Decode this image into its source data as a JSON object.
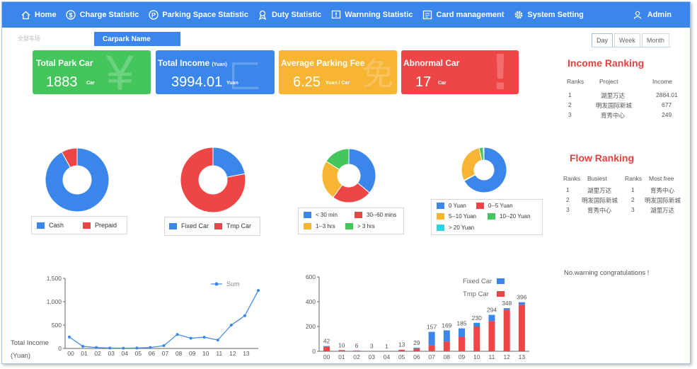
{
  "nav": {
    "items": [
      {
        "label": "Home",
        "icon": "home-icon"
      },
      {
        "label": "Charge Statistic",
        "icon": "dollar-icon"
      },
      {
        "label": "Parking Space Statistic",
        "icon": "parking-icon"
      },
      {
        "label": "Duty Statistic",
        "icon": "duty-icon"
      },
      {
        "label": "Warnning Statistic",
        "icon": "warning-icon"
      },
      {
        "label": "Card management",
        "icon": "card-icon"
      },
      {
        "label": "System Setting",
        "icon": "gear-icon"
      }
    ],
    "user": "Admin"
  },
  "filter": {
    "selected": "全部车场",
    "carpark_label": "Carpark Name"
  },
  "range_tabs": [
    "Day",
    "Week",
    "Month"
  ],
  "colors": {
    "nav_blue": "#3a86ea",
    "green": "#45c65c",
    "blue": "#3a86ea",
    "orange": "#f8b433",
    "red": "#ee4646",
    "cyan": "#2ed3e6"
  },
  "cards": [
    {
      "title": "Total Park Car",
      "title_unit": "",
      "value": "1883",
      "unit": "Car",
      "bg_glyph": "(¥"
    },
    {
      "title": "Total Income",
      "title_unit": "(Yuan)",
      "value": "3994.01",
      "unit": "Yuan",
      "bg_glyph": "¬"
    },
    {
      "title": "Average Parking Fee",
      "title_unit": "",
      "value": "6.25",
      "unit": "Yuan / Car",
      "bg_glyph": "免"
    },
    {
      "title": "Abnormal  Car",
      "title_unit": "",
      "value": "17",
      "unit": "Car",
      "bg_glyph": "!"
    }
  ],
  "income_ranking": {
    "title": "Income Ranking",
    "headers": [
      "Ranks",
      "Project",
      "Income"
    ],
    "rows": [
      [
        "1",
        "湖里万达",
        "2884.01"
      ],
      [
        "2",
        "明发国际新城",
        "677"
      ],
      [
        "3",
        "育秀中心",
        "249"
      ]
    ]
  },
  "flow_ranking": {
    "title": "Flow Ranking",
    "headers": [
      "Ranks",
      "Busiest",
      "Ranks",
      "Most free"
    ],
    "rows": [
      [
        "1",
        "湖里万达",
        "1",
        "育秀中心"
      ],
      [
        "2",
        "明发国际新城",
        "2",
        "明发国际新城"
      ],
      [
        "3",
        "育秀中心",
        "3",
        "湖里万达"
      ]
    ]
  },
  "warning_text": "No.warning  congratulations !",
  "pie_legends": {
    "pay": [
      "Cash",
      "Prepaid"
    ],
    "cartype": [
      "Fixed Car",
      "Tmp Car"
    ],
    "duration": [
      "< 30 min",
      "30--60 mins",
      "1--3 hrs",
      "> 3 hrs"
    ],
    "fee": [
      "0 Yuan",
      "0--5 Yuan",
      "5--10 Yuan",
      "10--20 Yuan",
      "> 20 Yuan"
    ]
  },
  "chart_data": [
    {
      "type": "pie",
      "categories": [
        "Cash",
        "Prepaid"
      ],
      "values": [
        92,
        8
      ],
      "colors": [
        "#3a86ea",
        "#ee4646"
      ]
    },
    {
      "type": "pie",
      "categories": [
        "Fixed Car",
        "Tmp Car"
      ],
      "values": [
        22,
        78
      ],
      "colors": [
        "#3a86ea",
        "#ee4646"
      ]
    },
    {
      "type": "pie",
      "categories": [
        "< 30 min",
        "30--60 mins",
        "1--3 hrs",
        "> 3 hrs"
      ],
      "values": [
        36,
        24,
        24,
        16
      ],
      "colors": [
        "#3a86ea",
        "#ee4646",
        "#f8b433",
        "#45c65c"
      ]
    },
    {
      "type": "pie",
      "categories": [
        "0 Yuan",
        "0--5 Yuan",
        "5--10 Yuan",
        "10--20 Yuan",
        "> 20 Yuan"
      ],
      "values": [
        67,
        0.5,
        29,
        3,
        0.5
      ],
      "colors": [
        "#3a86ea",
        "#ee4646",
        "#f8b433",
        "#45c65c",
        "#2ed3e6"
      ]
    },
    {
      "type": "line",
      "x": [
        "00",
        "01",
        "02",
        "03",
        "04",
        "05",
        "06",
        "07",
        "08",
        "09",
        "10",
        "11",
        "12",
        "13"
      ],
      "series": [
        {
          "name": "Sum",
          "values": [
            245,
            45,
            20,
            10,
            5,
            10,
            20,
            60,
            300,
            220,
            240,
            180,
            500,
            700,
            1240
          ]
        }
      ],
      "ylabel": "Total Income\n(Yuan)",
      "ylim": [
        0,
        1500
      ],
      "yticks": [
        "0",
        "500",
        "1,000",
        "1,500"
      ]
    },
    {
      "type": "bar",
      "categories": [
        "00",
        "01",
        "02",
        "03",
        "04",
        "05",
        "06",
        "07",
        "08",
        "09",
        "10",
        "11",
        "12",
        "13"
      ],
      "series": [
        {
          "name": "Fixed Car",
          "values": [
            5,
            1,
            1,
            1,
            0,
            1,
            8,
            110,
            90,
            65,
            30,
            50,
            16,
            20
          ]
        },
        {
          "name": "Tmp Car",
          "values": [
            37,
            9,
            5,
            2,
            1,
            12,
            21,
            47,
            79,
            120,
            200,
            244,
            332,
            376
          ]
        }
      ],
      "totals": [
        "42",
        "10",
        "6",
        "3",
        "1",
        "13",
        "29",
        "157",
        "169",
        "185",
        "230",
        "294",
        "348",
        "396"
      ],
      "ylim": [
        0,
        600
      ],
      "yticks": [
        "0",
        "200",
        "400",
        "600"
      ]
    }
  ]
}
